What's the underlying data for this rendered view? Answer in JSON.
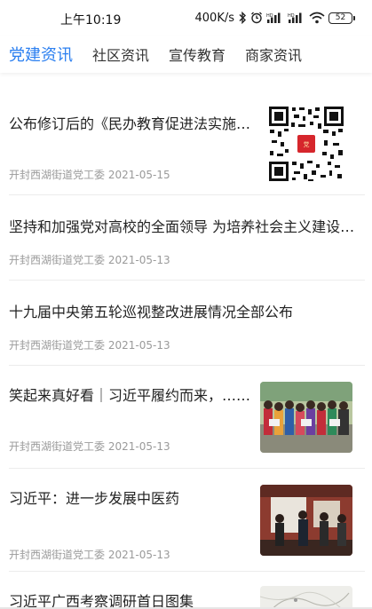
{
  "status_bar": {
    "time": "上午10:19",
    "network_speed": "400K/s",
    "battery": "52"
  },
  "tabs": [
    {
      "label": "党建资讯",
      "active": true
    },
    {
      "label": "社区资讯",
      "active": false
    },
    {
      "label": "宣传教育",
      "active": false
    },
    {
      "label": "商家资讯",
      "active": false
    }
  ],
  "news": [
    {
      "title": "公布修订后的《民办教育促进法实施条例》",
      "source": "开封西湖街道党工委",
      "date": "2021-05-15",
      "thumb": "qr-code"
    },
    {
      "title": "坚持和加强党对高校的全面领导 为培养社会主义建设者和接班人",
      "source": "开封西湖街道党工委",
      "date": "2021-05-13",
      "thumb": ""
    },
    {
      "title": "十九届中央第五轮巡视整改进展情况全部公布",
      "source": "开封西湖街道党工委",
      "date": "2021-05-13",
      "thumb": ""
    },
    {
      "title": "笑起来真好看｜习近平履约而来，……",
      "source": "开封西湖街道党工委",
      "date": "2021-05-13",
      "thumb": "group-photo"
    },
    {
      "title": "习近平：进一步发展中医药",
      "source": "开封西湖街道党工委",
      "date": "2021-05-13",
      "thumb": "inspection-photo"
    },
    {
      "title": "习近平广西考察调研首日图集",
      "source": "",
      "date": "",
      "thumb": "map-photo"
    }
  ],
  "colors": {
    "accent": "#2b7ff0",
    "text": "#222222",
    "meta": "#9a9a9a"
  }
}
